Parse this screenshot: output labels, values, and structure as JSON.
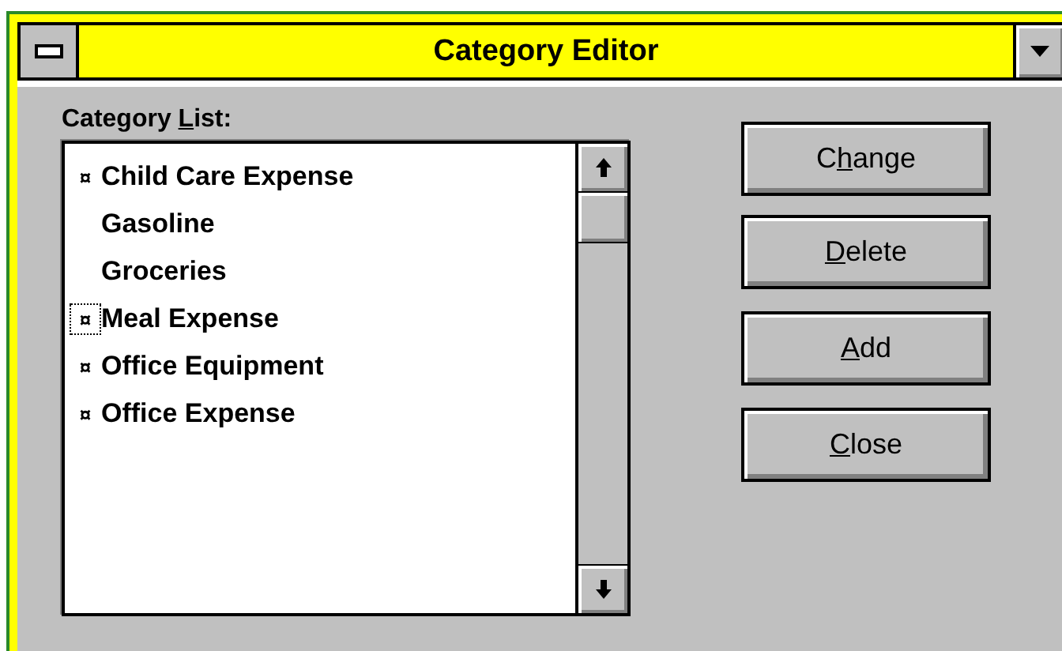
{
  "window": {
    "title": "Category Editor"
  },
  "list": {
    "label_parts": {
      "before": "Category ",
      "key": "L",
      "after": "ist:"
    },
    "items": [
      {
        "label": "Child Care Expense",
        "marked": true,
        "focused": false
      },
      {
        "label": "Gasoline",
        "marked": false,
        "focused": false
      },
      {
        "label": "Groceries",
        "marked": false,
        "focused": false
      },
      {
        "label": "Meal Expense",
        "marked": true,
        "focused": true
      },
      {
        "label": "Office Equipment",
        "marked": true,
        "focused": false
      },
      {
        "label": "Office Expense",
        "marked": true,
        "focused": false
      }
    ],
    "marker": "¤"
  },
  "buttons": [
    {
      "label_parts": {
        "before": "C",
        "key": "h",
        "after": "ange"
      }
    },
    {
      "label_parts": {
        "key": "D",
        "after": "elete"
      }
    },
    {
      "label_parts": {
        "key": "A",
        "after": "dd"
      }
    },
    {
      "label_parts": {
        "key": "C",
        "after": "lose"
      }
    }
  ]
}
